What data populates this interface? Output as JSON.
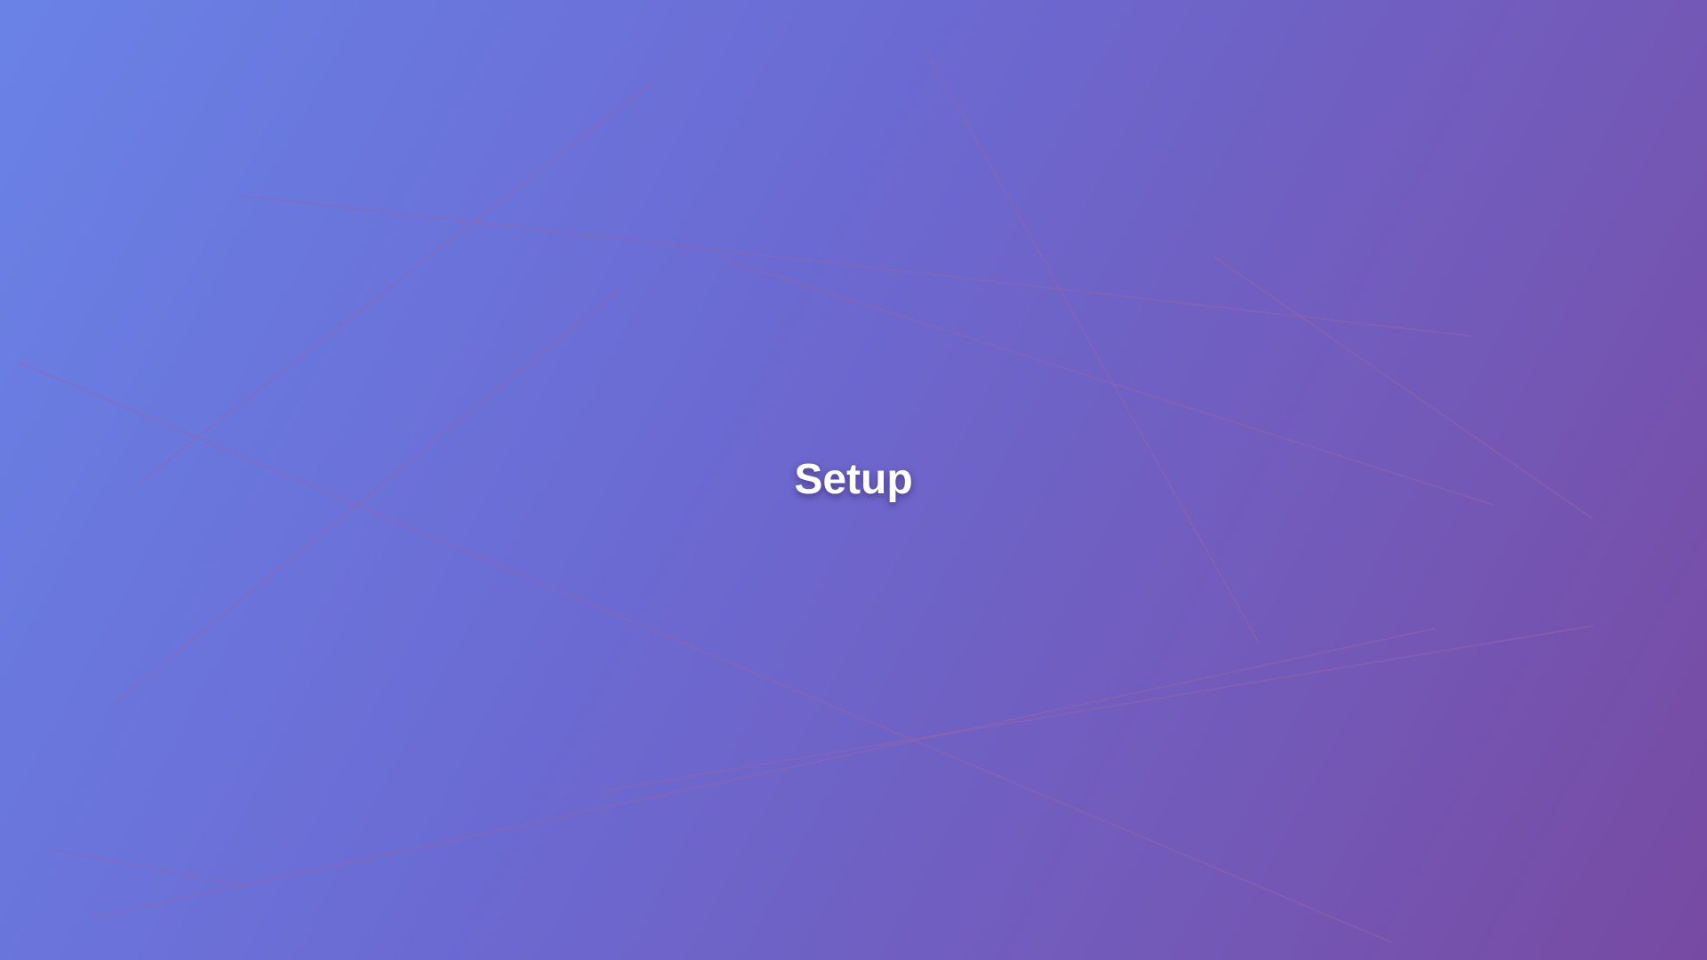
{
  "screen": {
    "title": "Setup"
  },
  "colors": {
    "gradient_start": "#6a82e6",
    "gradient_end": "#774aa2",
    "line": "#9664aa",
    "title": "#ffffff"
  }
}
